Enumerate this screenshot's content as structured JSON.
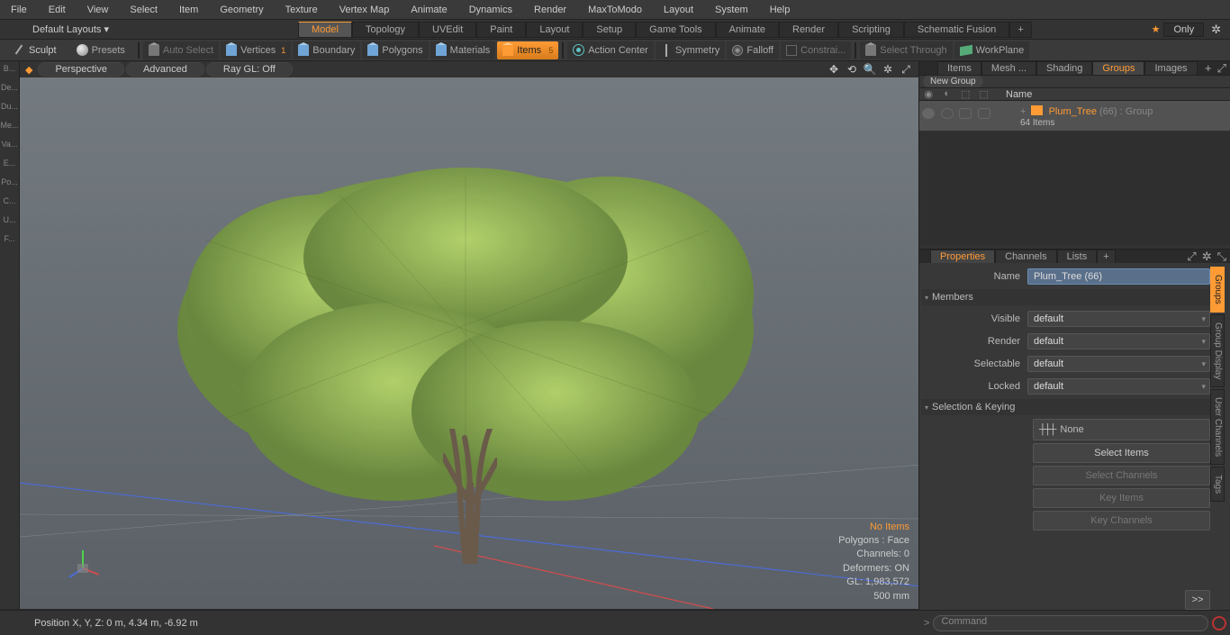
{
  "menu": [
    "File",
    "Edit",
    "View",
    "Select",
    "Item",
    "Geometry",
    "Texture",
    "Vertex Map",
    "Animate",
    "Dynamics",
    "Render",
    "MaxToModo",
    "Layout",
    "System",
    "Help"
  ],
  "defaultLayouts": "Default Layouts ▾",
  "workspaces": {
    "items": [
      "Model",
      "Topology",
      "UVEdit",
      "Paint",
      "Layout",
      "Setup",
      "Game Tools",
      "Animate",
      "Render",
      "Scripting",
      "Schematic Fusion"
    ],
    "active": 0,
    "only": "Only",
    "star": "★"
  },
  "toolbar": {
    "sculpt": "Sculpt",
    "presets": "Presets",
    "autoSelect": "Auto Select",
    "vertices": "Vertices",
    "vertCount": "1",
    "boundary": "Boundary",
    "polygons": "Polygons",
    "materials": "Materials",
    "items": "Items",
    "itemsCount": "5",
    "actionCenter": "Action Center",
    "symmetry": "Symmetry",
    "falloff": "Falloff",
    "constrain": "Constrai...",
    "selectThrough": "Select Through",
    "workplane": "WorkPlane"
  },
  "leftStrip": [
    "B...",
    "De...",
    "Du...",
    "Me...",
    "Va...",
    "E...",
    "Po...",
    "C...",
    "U...",
    "F..."
  ],
  "viewportPills": {
    "p1": "Perspective",
    "p2": "Advanced",
    "p3": "Ray GL: Off"
  },
  "viewportStats": {
    "noItems": "No Items",
    "polys": "Polygons : Face",
    "channels": "Channels: 0",
    "deformers": "Deformers: ON",
    "gl": "GL: 1,983,572",
    "unit": "500 mm"
  },
  "rightTabs": {
    "items": [
      "Items",
      "Mesh ...",
      "Shading",
      "Groups",
      "Images"
    ],
    "active": 3
  },
  "newGroup": "New Group",
  "listHeader": {
    "name": "Name"
  },
  "treeItem": {
    "name": "Plum_Tree",
    "suffix": "(66)",
    "type": " : Group",
    "count": "64 Items"
  },
  "propTabs": {
    "items": [
      "Properties",
      "Channels",
      "Lists"
    ],
    "active": 0
  },
  "sideTabs": [
    "Groups",
    "Group Display",
    "User Channels",
    "Tags"
  ],
  "props": {
    "nameLabel": "Name",
    "nameValue": "Plum_Tree (66)",
    "members": "Members",
    "visible": "Visible",
    "render": "Render",
    "selectable": "Selectable",
    "locked": "Locked",
    "defaultv": "default",
    "selKey": "Selection & Keying",
    "none": "None",
    "btns": {
      "selItems": "Select Items",
      "selChannels": "Select Channels",
      "keyItems": "Key Items",
      "keyChannels": "Key Channels",
      "arrow": ">>"
    }
  },
  "status": {
    "pos": "Position X, Y, Z:   0 m, 4.34 m, -6.92 m",
    "cmd": "Command",
    "prompt": ">"
  }
}
